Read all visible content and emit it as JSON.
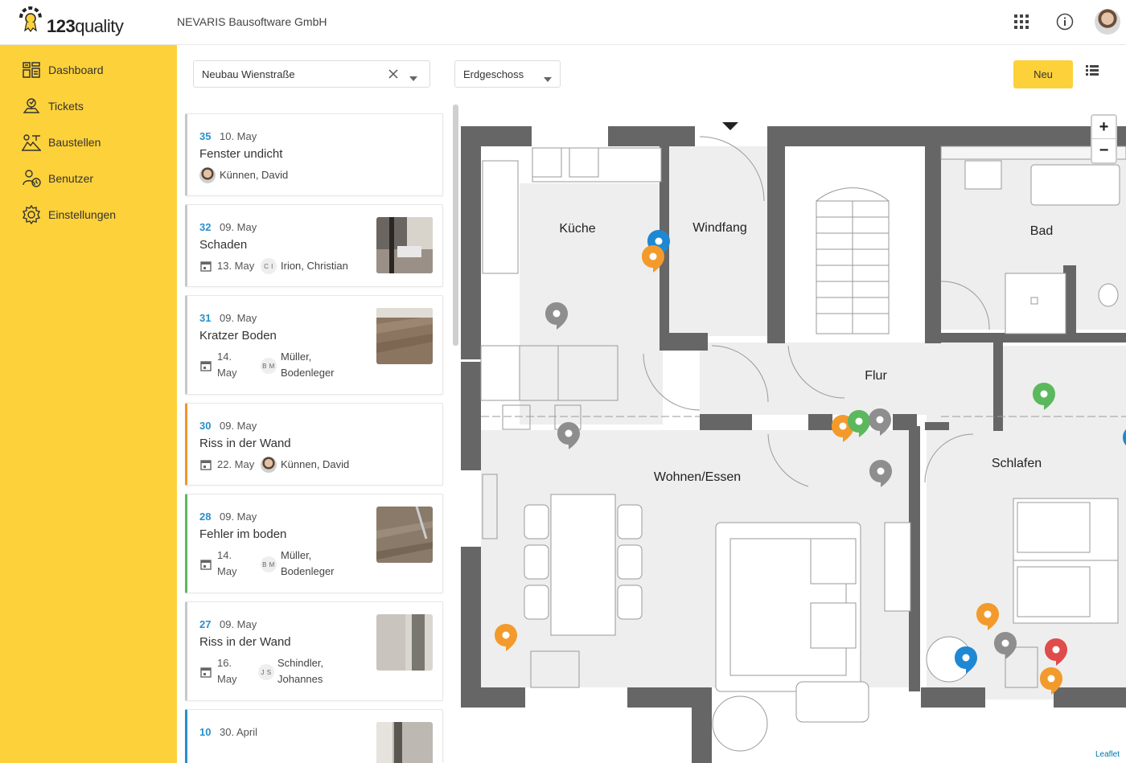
{
  "header": {
    "logo_prefix": "123",
    "logo_suffix": "quality",
    "company": "NEVARIS Bausoftware GmbH",
    "icons": [
      "apps-grid-icon",
      "info-icon",
      "user-avatar"
    ]
  },
  "sidebar": {
    "items": [
      {
        "label": "Dashboard",
        "icon": "dashboard-icon"
      },
      {
        "label": "Tickets",
        "icon": "tickets-icon"
      },
      {
        "label": "Baustellen",
        "icon": "construction-site-icon"
      },
      {
        "label": "Benutzer",
        "icon": "users-icon"
      },
      {
        "label": "Einstellungen",
        "icon": "settings-gear-icon"
      }
    ]
  },
  "toolbar": {
    "project_value": "Neubau Wienstraße",
    "floor_value": "Erdgeschoss",
    "new_label": "Neu"
  },
  "tickets": [
    {
      "num": "35",
      "date": "10. May",
      "title": "Fenster undicht",
      "due": "",
      "user": "Künnen, David",
      "avatar": "photo",
      "initials": "",
      "color": "#c8c8c8",
      "thumb": false
    },
    {
      "num": "32",
      "date": "09. May",
      "title": "Schaden",
      "due": "13. May",
      "user": "Irion, Christian",
      "avatar": "initials",
      "initials": "C I",
      "color": "#c8c8c8",
      "thumb": true
    },
    {
      "num": "31",
      "date": "09. May",
      "title": "Kratzer Boden",
      "due": "14. May",
      "user": "Müller, Bodenleger",
      "avatar": "initials",
      "initials": "B M",
      "color": "#c8c8c8",
      "thumb": true
    },
    {
      "num": "30",
      "date": "09. May",
      "title": "Riss in der Wand",
      "due": "22. May",
      "user": "Künnen, David",
      "avatar": "photo",
      "initials": "",
      "color": "#f0962a",
      "thumb": false
    },
    {
      "num": "28",
      "date": "09. May",
      "title": "Fehler im boden",
      "due": "14. May",
      "user": "Müller, Bodenleger",
      "avatar": "initials",
      "initials": "B M",
      "color": "#5cb85c",
      "thumb": true
    },
    {
      "num": "27",
      "date": "09. May",
      "title": "Riss in der Wand",
      "due": "16. May",
      "user": "Schindler, Johannes",
      "avatar": "initials",
      "initials": "J S",
      "color": "#c8c8c8",
      "thumb": true
    },
    {
      "num": "10",
      "date": "30. April",
      "title": "",
      "due": "",
      "user": "",
      "avatar": "none",
      "initials": "",
      "color": "#2a8fc9",
      "thumb": true
    }
  ],
  "map": {
    "rooms": [
      "Küche",
      "Windfang",
      "Bad",
      "Flur",
      "Wohnen/Essen",
      "Schlafen"
    ],
    "zoom_in": "+",
    "zoom_out": "−",
    "attribution": "Leaflet",
    "marker_colors": {
      "blue": "#1e88d2",
      "orange": "#f39a2d",
      "gray": "#8e8e8e",
      "green": "#5cb85c",
      "red": "#e04b4b"
    }
  }
}
